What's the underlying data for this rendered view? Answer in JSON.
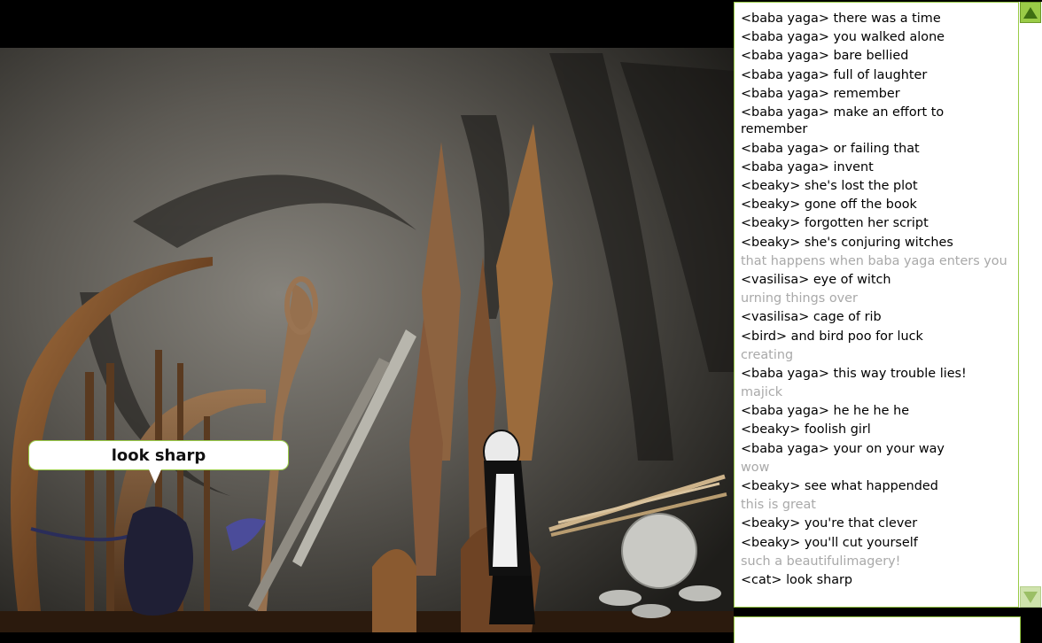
{
  "scene": {
    "speech_bubble": "look sharp"
  },
  "chat": {
    "messages": [
      {
        "text": "<baba yaga> there was a time",
        "kind": "chat"
      },
      {
        "text": "<baba yaga> you walked alone",
        "kind": "chat"
      },
      {
        "text": "<baba yaga> bare bellied",
        "kind": "chat"
      },
      {
        "text": "<baba yaga> full of laughter",
        "kind": "chat"
      },
      {
        "text": "<baba yaga> remember",
        "kind": "chat"
      },
      {
        "text": "<baba yaga> make an effort to remember",
        "kind": "chat"
      },
      {
        "text": "<baba yaga> or failing that",
        "kind": "chat"
      },
      {
        "text": "<baba yaga> invent",
        "kind": "chat"
      },
      {
        "text": "<beaky> she's lost the plot",
        "kind": "chat"
      },
      {
        "text": "<beaky> gone off the book",
        "kind": "chat"
      },
      {
        "text": "<beaky> forgotten her script",
        "kind": "chat"
      },
      {
        "text": "<beaky> she's conjuring witches",
        "kind": "chat"
      },
      {
        "text": "that happens when baba yaga enters you",
        "kind": "system"
      },
      {
        "text": "<vasilisa> eye of witch",
        "kind": "chat"
      },
      {
        "text": "urning things over",
        "kind": "system"
      },
      {
        "text": "<vasilisa> cage of rib",
        "kind": "chat"
      },
      {
        "text": "<bird> and bird poo for luck",
        "kind": "chat"
      },
      {
        "text": "creating",
        "kind": "system"
      },
      {
        "text": "<baba yaga> this way trouble lies!",
        "kind": "chat"
      },
      {
        "text": "majick",
        "kind": "system"
      },
      {
        "text": "<baba yaga> he he he he",
        "kind": "chat"
      },
      {
        "text": "<beaky> foolish girl",
        "kind": "chat"
      },
      {
        "text": "<baba yaga> your on your way",
        "kind": "chat"
      },
      {
        "text": "wow",
        "kind": "system"
      },
      {
        "text": "<beaky> see what happended",
        "kind": "chat"
      },
      {
        "text": "this is great",
        "kind": "system"
      },
      {
        "text": "<beaky> you're that clever",
        "kind": "chat"
      },
      {
        "text": "<beaky> you'll cut yourself",
        "kind": "chat"
      },
      {
        "text": "such a beautifulimagery!",
        "kind": "system"
      },
      {
        "text": "<cat> look sharp",
        "kind": "chat"
      }
    ],
    "input_value": ""
  },
  "colors": {
    "accent_green": "#9acb47",
    "system_text": "#a9a9a9"
  }
}
